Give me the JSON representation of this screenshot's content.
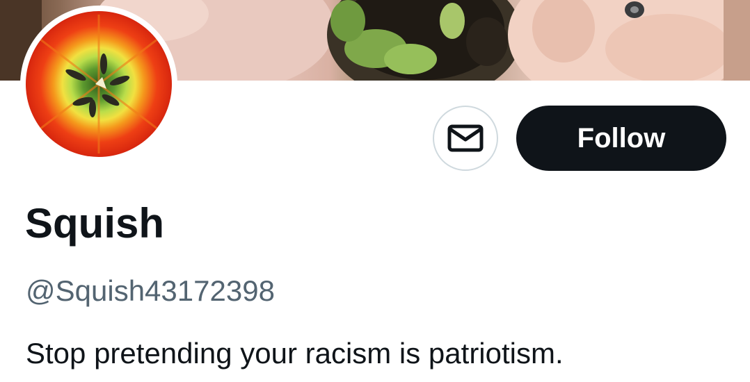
{
  "profile": {
    "display_name": "Squish",
    "handle": "@Squish43172398",
    "bio": "Stop pretending your racism is patriotism."
  },
  "actions": {
    "follow_label": "Follow",
    "message_icon": "envelope-icon"
  },
  "colors": {
    "primary_text": "#0f1419",
    "secondary_text": "#536471",
    "follow_button_bg": "#0f1419",
    "follow_button_text": "#ffffff",
    "button_border": "#cfd9de"
  }
}
